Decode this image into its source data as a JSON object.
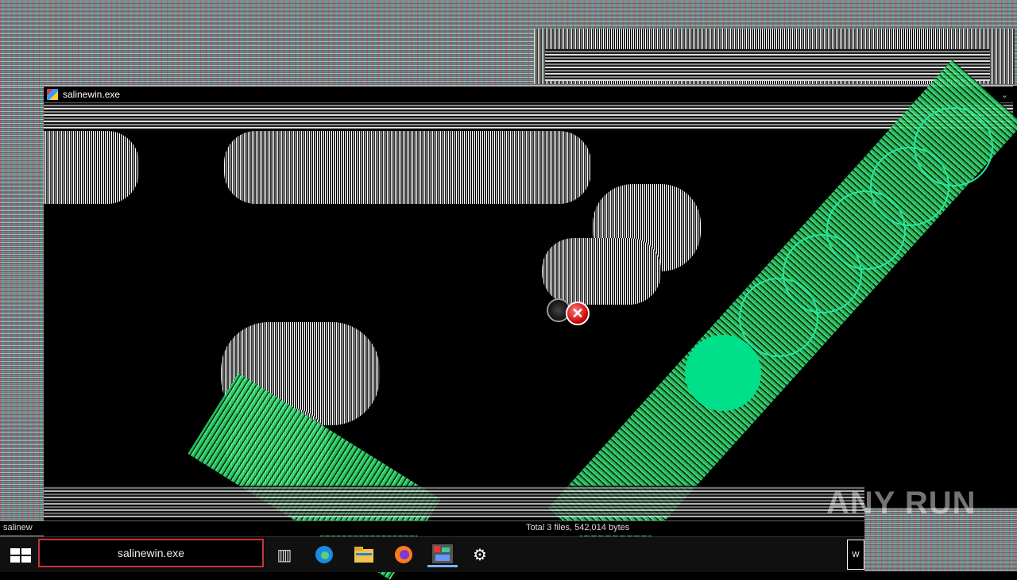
{
  "window": {
    "title": "salinewin.exe"
  },
  "status": {
    "left_text": "salinew",
    "right_text": "Total 3 files, 542,014 bytes"
  },
  "watermark": "ANY RUN",
  "taskbar": {
    "search_text": "salinewin.exe",
    "tray_text": "W"
  },
  "dialog": {
    "error_icon_glyph": "✕"
  },
  "colors": {
    "ball": "#00e08a",
    "green_stripe": "#2bd36a",
    "error_red": "#c40000"
  },
  "icons": [
    "windows-start-icon",
    "task-view-icon",
    "edge-icon",
    "file-explorer-icon",
    "firefox-icon",
    "salinewin-app-icon",
    "settings-gear-icon"
  ]
}
